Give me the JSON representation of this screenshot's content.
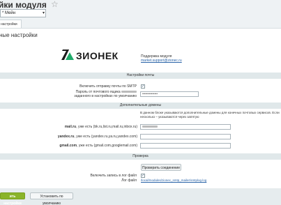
{
  "header": {
    "title": "йки модуля",
    "star": "☆"
  },
  "site_select": {
    "value": "* Мейн"
  },
  "tab": {
    "label": "настройки"
  },
  "panel": {
    "title": "ные настройки"
  },
  "brand": {
    "name": "ЗИОНЕК",
    "support_label": "Поддержка модуля",
    "support_email": "market.support@zionec.ru",
    "colors": {
      "logo_green": "#1faa6a",
      "logo_dark": "#1a1a1a",
      "save_green": "#8ab42a"
    }
  },
  "mail_settings": {
    "header": "Настройки почты",
    "smtp_label": "Включить отправку почты по SMTP",
    "smtp_checked": "✓",
    "password_label_1": "Пароль от почтового ящика",
    "password_label_2": "заданного в настройках по умолчанию",
    "password_value": "••••••••••••••"
  },
  "domains": {
    "header": "Дополнительные домены",
    "note": "В данном блоке указываются дополнительные домены для конечных почтовых сервисов. Если несколько – указываются через запятую",
    "mail_label": "mail.ru",
    "mail_label_rest": ", уже есть (bk.ru,list.ru,mail.ru,inbox.ru)",
    "yandex_label": "yandex.ru",
    "yandex_label_rest": ", уже есть (yandex.ru,ya.ru,yandex.com)",
    "gmail_label": "gmail.com",
    "gmail_label_rest": ", уже есть (gmail.com,googlemail.com)"
  },
  "check": {
    "header": "Проверка",
    "check_button": "Проверить соединение",
    "log_label": "Включить запись в лог файл",
    "log_checked": "✓",
    "logfile_label": "Лог файл",
    "logfile_path": "/local/modules/zionec_smtp_mailer/smtplog.log"
  },
  "footer": {
    "save": "ить настройки",
    "default": "Установить по умолчанию"
  }
}
